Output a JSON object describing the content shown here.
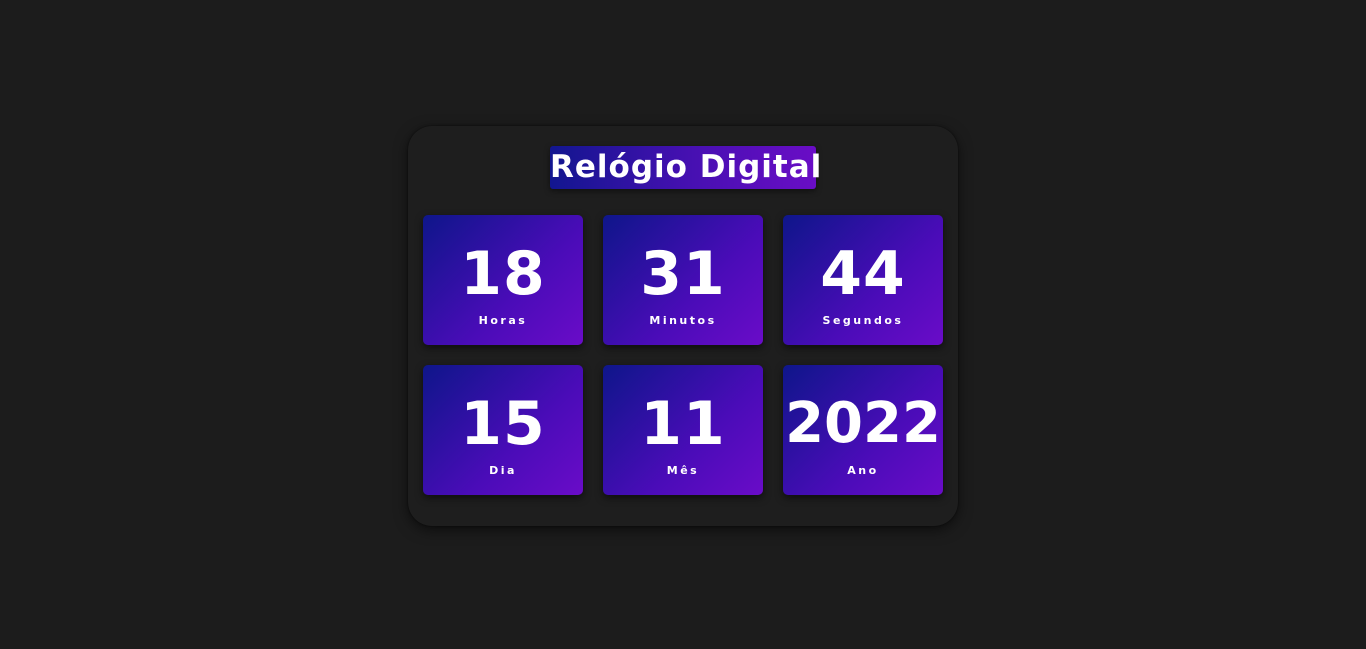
{
  "title": "Relógio Digital",
  "time": {
    "hours": {
      "value": "18",
      "label": "Horas"
    },
    "minutes": {
      "value": "31",
      "label": "Minutos"
    },
    "seconds": {
      "value": "44",
      "label": "Segundos"
    }
  },
  "date": {
    "day": {
      "value": "15",
      "label": "Dia"
    },
    "month": {
      "value": "11",
      "label": "Mês"
    },
    "year": {
      "value": "2022",
      "label": "Ano"
    }
  },
  "colors": {
    "background": "#1c1c1c",
    "panel": "#1e1e1e",
    "gradient_start": "#0e168a",
    "gradient_end": "#6a0cc8",
    "text": "#ffffff"
  }
}
